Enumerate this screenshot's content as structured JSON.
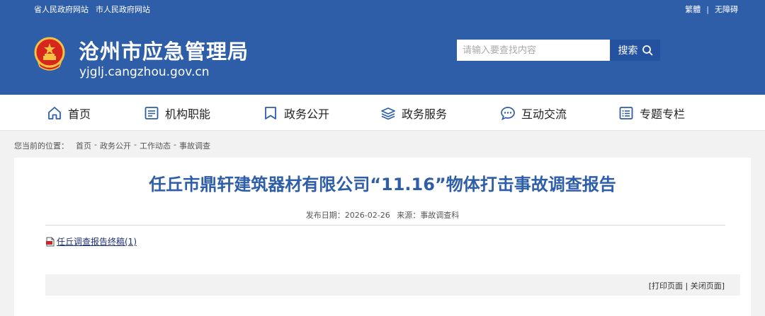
{
  "topbar": {
    "left_links": [
      "省人民政府网站",
      "市人民政府网站"
    ],
    "traditional": "繁體",
    "separator": "|",
    "accessibility": "无障碍"
  },
  "site": {
    "title": "沧州市应急管理局",
    "domain": "yjglj.cangzhou.gov.cn"
  },
  "search": {
    "placeholder": "请输入要查找内容",
    "button_label": "搜索"
  },
  "nav": {
    "items": [
      {
        "label": "首页",
        "icon": "home-icon"
      },
      {
        "label": "机构职能",
        "icon": "document-icon"
      },
      {
        "label": "政务公开",
        "icon": "bookmark-icon"
      },
      {
        "label": "政务服务",
        "icon": "layers-icon"
      },
      {
        "label": "互动交流",
        "icon": "chat-icon"
      },
      {
        "label": "专题专栏",
        "icon": "list-icon"
      }
    ]
  },
  "breadcrumb": {
    "label": "您当前的位置：",
    "items": [
      "首页",
      "政务公开",
      "工作动态",
      "事故调查"
    ],
    "separator": "-"
  },
  "article": {
    "title": "任丘市鼎轩建筑器材有限公司“11.16”物体打击事故调查报告",
    "date_label": "发布日期：2026-02-26",
    "source_label": "来源：事故调查科",
    "attachment": "任丘调查报告终稿(1)"
  },
  "toolbar": {
    "open_bracket": "[",
    "print": "打印页面",
    "separator": " | ",
    "close": "关闭页面",
    "close_bracket": "]"
  },
  "colors": {
    "header_bg": "#2f5ea9",
    "title_color": "#2f5ea9",
    "search_button": "#2452a0"
  }
}
